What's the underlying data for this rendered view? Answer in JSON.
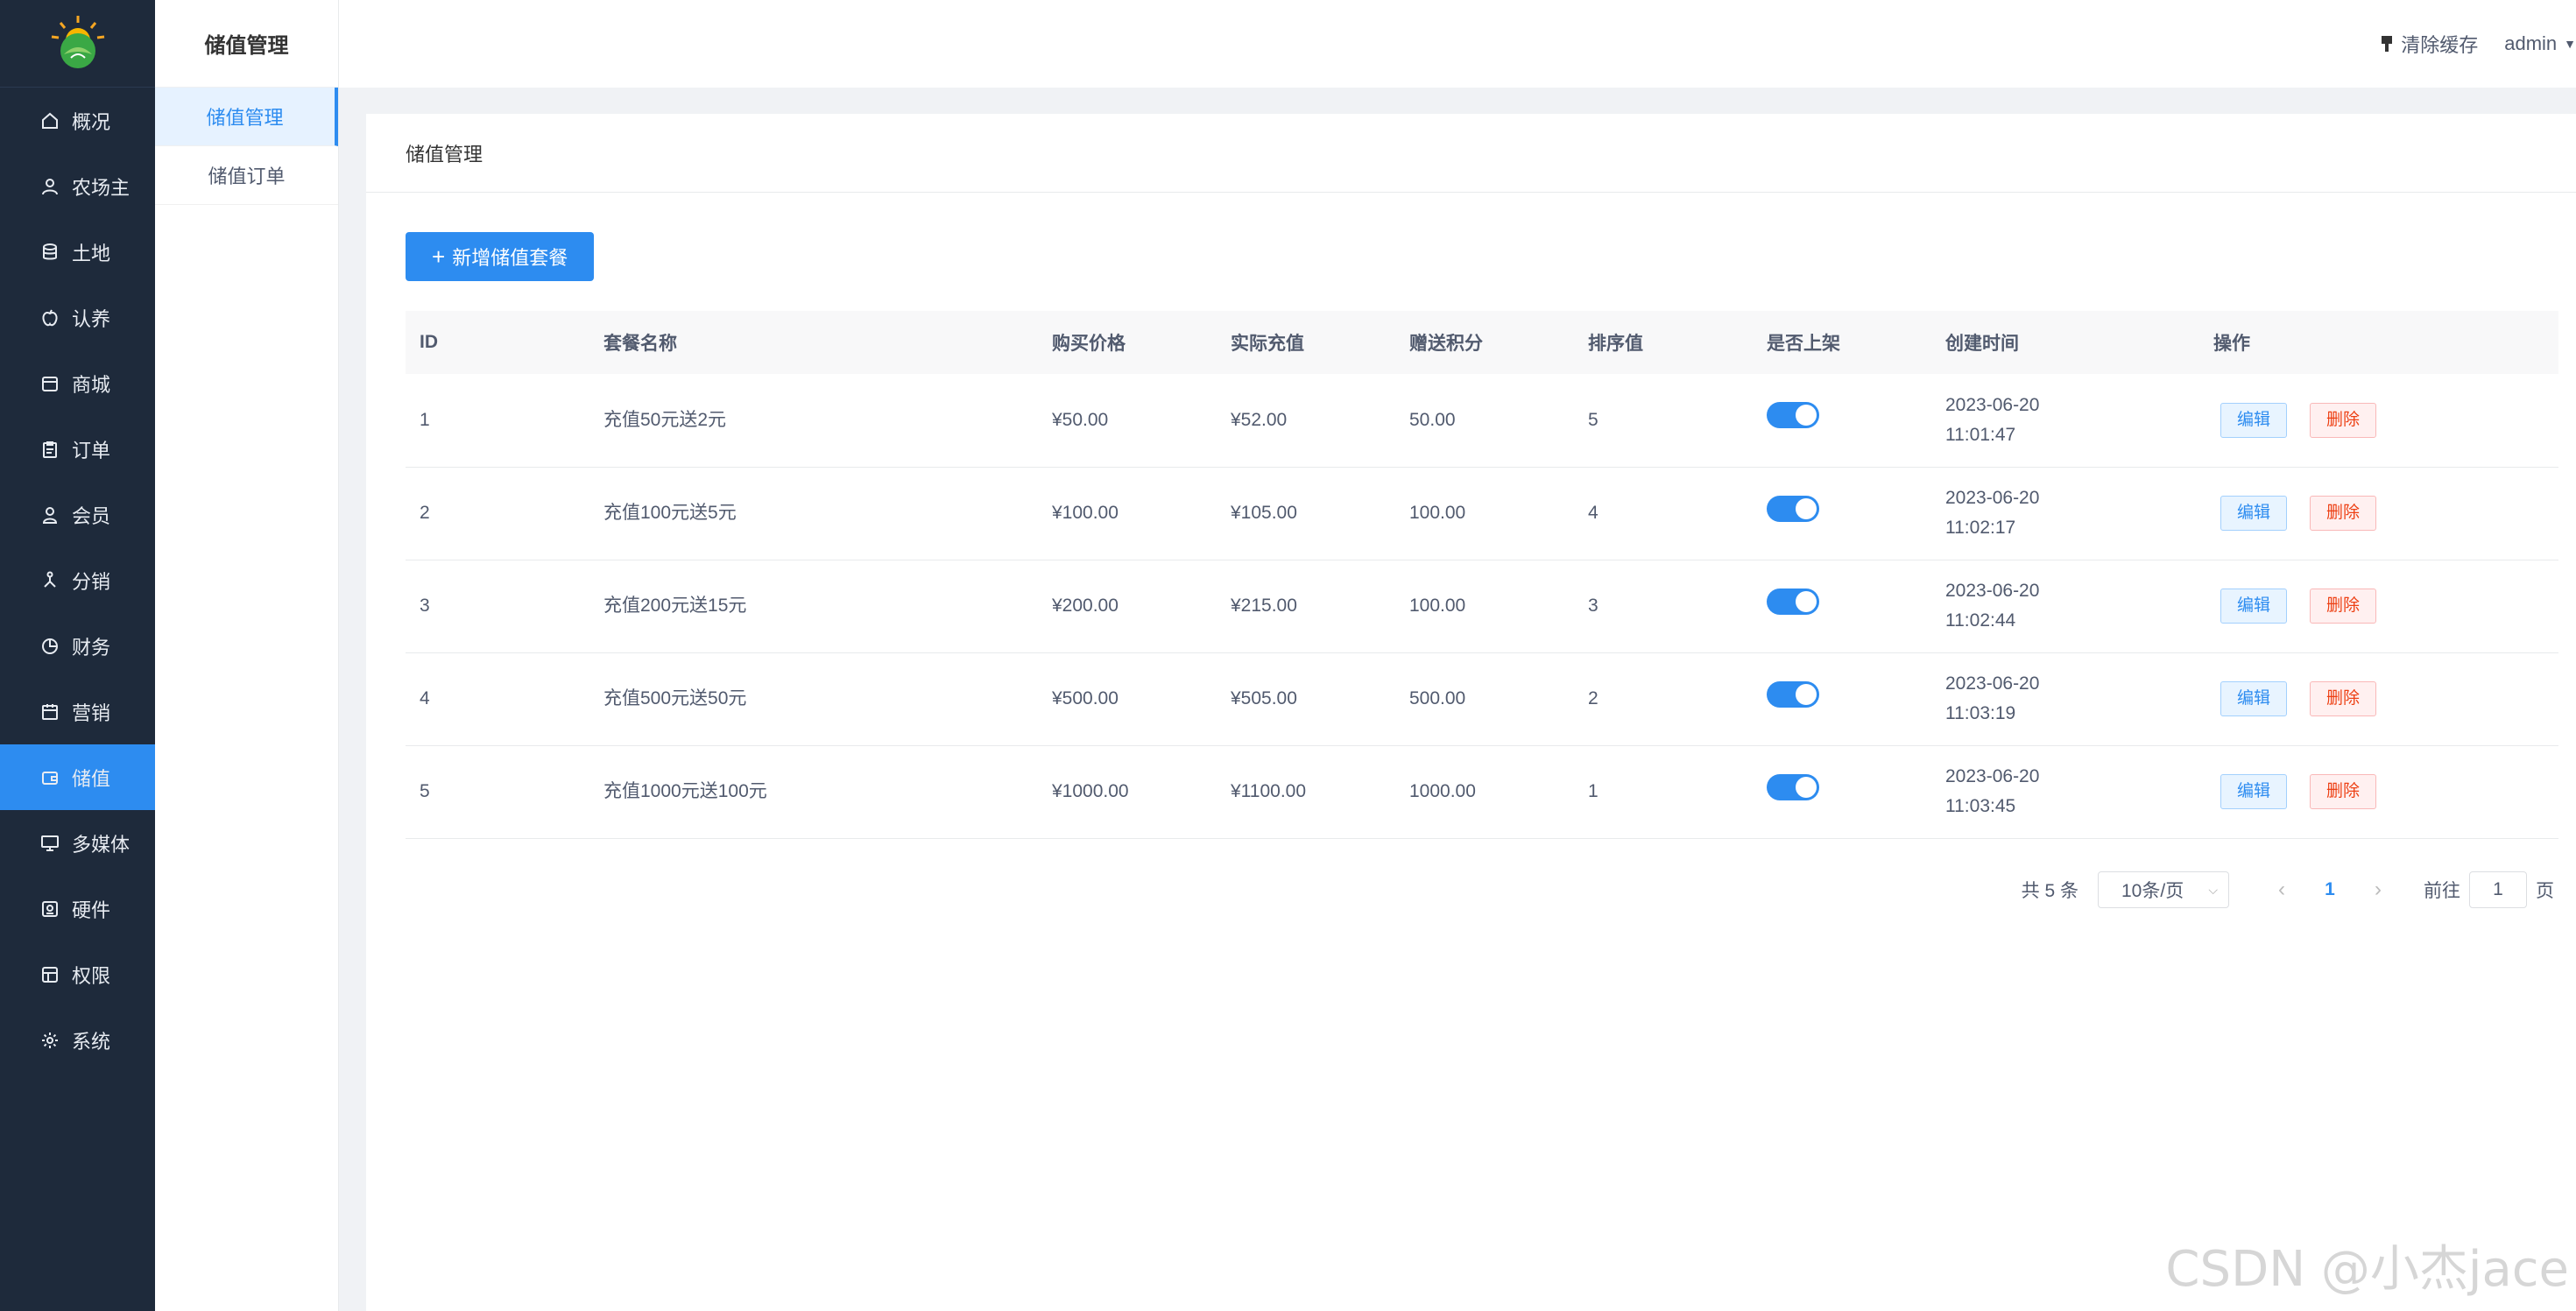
{
  "sidebar": {
    "items": [
      {
        "label": "概况",
        "icon": "home-icon"
      },
      {
        "label": "农场主",
        "icon": "user-icon"
      },
      {
        "label": "土地",
        "icon": "database-icon"
      },
      {
        "label": "认养",
        "icon": "apple-icon"
      },
      {
        "label": "商城",
        "icon": "store-icon"
      },
      {
        "label": "订单",
        "icon": "clipboard-icon"
      },
      {
        "label": "会员",
        "icon": "member-icon"
      },
      {
        "label": "分销",
        "icon": "network-icon"
      },
      {
        "label": "财务",
        "icon": "pie-chart-icon"
      },
      {
        "label": "营销",
        "icon": "calendar-icon"
      },
      {
        "label": "储值",
        "icon": "wallet-icon",
        "active": true
      },
      {
        "label": "多媒体",
        "icon": "monitor-icon"
      },
      {
        "label": "硬件",
        "icon": "device-icon"
      },
      {
        "label": "权限",
        "icon": "lock-icon"
      },
      {
        "label": "系统",
        "icon": "gear-icon"
      }
    ]
  },
  "submenu": {
    "title": "储值管理",
    "items": [
      {
        "label": "储值管理",
        "active": true
      },
      {
        "label": "储值订单",
        "active": false
      }
    ]
  },
  "header": {
    "clear_cache": "清除缓存",
    "user": "admin"
  },
  "card": {
    "title": "储值管理",
    "add_button": "新增储值套餐"
  },
  "table": {
    "columns": [
      "ID",
      "套餐名称",
      "购买价格",
      "实际充值",
      "赠送积分",
      "排序值",
      "是否上架",
      "创建时间",
      "操作"
    ],
    "rows": [
      {
        "id": "1",
        "name": "充值50元送2元",
        "price": "¥50.00",
        "actual": "¥52.00",
        "points": "50.00",
        "sort": "5",
        "on_shelf": true,
        "date": "2023-06-20",
        "time": "11:01:47"
      },
      {
        "id": "2",
        "name": "充值100元送5元",
        "price": "¥100.00",
        "actual": "¥105.00",
        "points": "100.00",
        "sort": "4",
        "on_shelf": true,
        "date": "2023-06-20",
        "time": "11:02:17"
      },
      {
        "id": "3",
        "name": "充值200元送15元",
        "price": "¥200.00",
        "actual": "¥215.00",
        "points": "100.00",
        "sort": "3",
        "on_shelf": true,
        "date": "2023-06-20",
        "time": "11:02:44"
      },
      {
        "id": "4",
        "name": "充值500元送50元",
        "price": "¥500.00",
        "actual": "¥505.00",
        "points": "500.00",
        "sort": "2",
        "on_shelf": true,
        "date": "2023-06-20",
        "time": "11:03:19"
      },
      {
        "id": "5",
        "name": "充值1000元送100元",
        "price": "¥1000.00",
        "actual": "¥1100.00",
        "points": "1000.00",
        "sort": "1",
        "on_shelf": true,
        "date": "2023-06-20",
        "time": "11:03:45"
      }
    ],
    "edit_label": "编辑",
    "delete_label": "删除"
  },
  "pagination": {
    "total": "共 5 条",
    "page_size": "10条/页",
    "current_page": "1",
    "goto_label": "前往",
    "goto_value": "1",
    "page_unit": "页"
  },
  "watermark": "CSDN @小杰jace",
  "colors": {
    "sidebar_bg": "#1e2a3b",
    "accent": "#2d8cf0",
    "danger": "#ed4014"
  }
}
